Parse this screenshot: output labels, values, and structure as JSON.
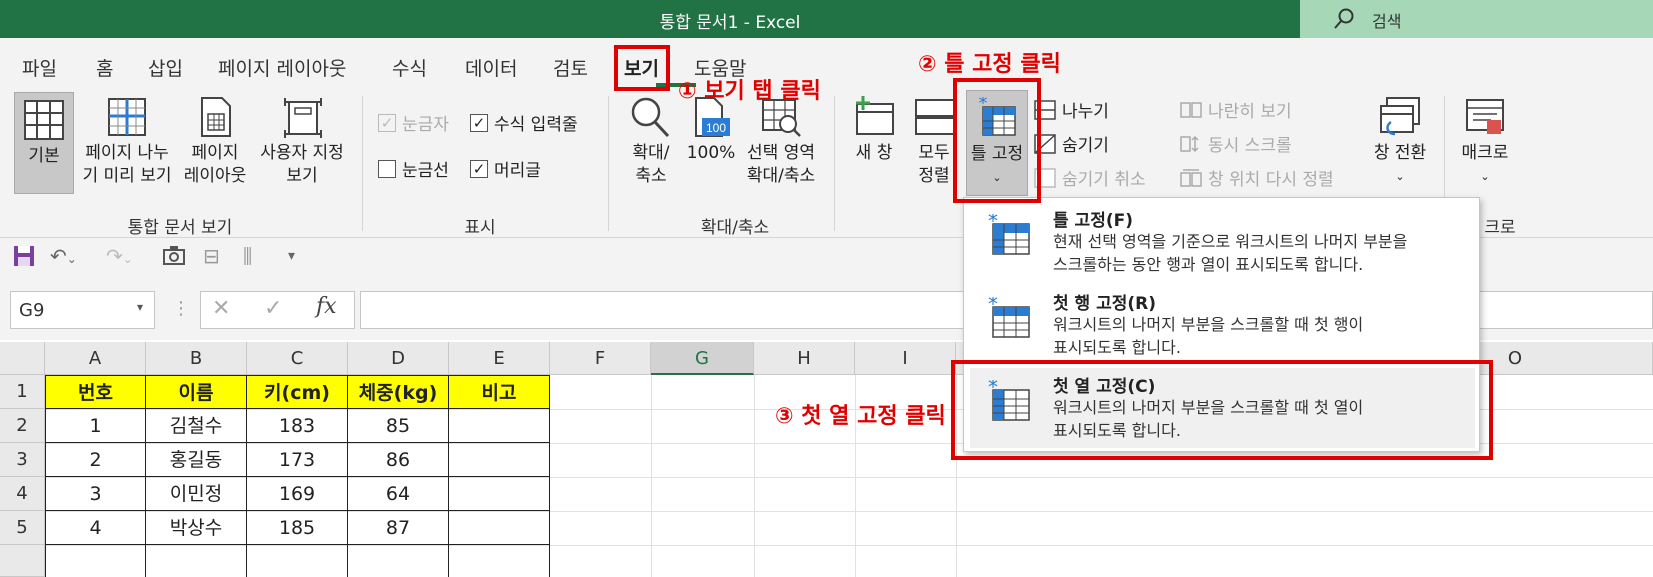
{
  "window": {
    "title": "통합 문서1  -  Excel",
    "search_label": "검색"
  },
  "tabs": [
    "파일",
    "홈",
    "삽입",
    "페이지 레이아웃",
    "수식",
    "데이터",
    "검토",
    "보기",
    "도움말"
  ],
  "ribbon": {
    "workbook_views": {
      "label": "통합 문서 보기",
      "normal": "기본",
      "page_break_1": "페이지 나누",
      "page_break_2": "기 미리 보기",
      "page_layout_1": "페이지",
      "page_layout_2": "레이아웃",
      "custom_1": "사용자 지정",
      "custom_2": "보기"
    },
    "show": {
      "label": "표시",
      "ruler": "눈금자",
      "formula_bar": "수식 입력줄",
      "gridlines": "눈금선",
      "headings": "머리글"
    },
    "zoom": {
      "label": "확대/축소",
      "zoom_1": "확대/",
      "zoom_2": "축소",
      "hundred": "100%",
      "sel_1": "선택 영역",
      "sel_2": "확대/축소"
    },
    "window": {
      "new_window": "새 창",
      "arrange_1": "모두",
      "arrange_2": "정렬",
      "freeze": "틀 고정",
      "split": "나누기",
      "hide": "숨기기",
      "unhide": "숨기기 취소",
      "side_by_side": "나란히 보기",
      "sync_scroll": "동시 스크롤",
      "reset_pos": "창 위치 다시 정렬",
      "switch": "창 전환"
    },
    "macros": {
      "macro": "매크로",
      "label": "크로"
    }
  },
  "formula_bar": {
    "name_box": "G9",
    "fx": "fx",
    "value": ""
  },
  "columns": [
    "A",
    "B",
    "C",
    "D",
    "E",
    "F",
    "G",
    "H",
    "I",
    "O"
  ],
  "rows": [
    "1",
    "2",
    "3",
    "4",
    "5"
  ],
  "table": {
    "headers": [
      "번호",
      "이름",
      "키(cm)",
      "체중(kg)",
      "비고"
    ],
    "rows": [
      [
        "1",
        "김철수",
        "183",
        "85",
        ""
      ],
      [
        "2",
        "홍길동",
        "173",
        "86",
        ""
      ],
      [
        "3",
        "이민정",
        "169",
        "64",
        ""
      ],
      [
        "4",
        "박상수",
        "185",
        "87",
        ""
      ]
    ]
  },
  "freeze_menu": {
    "items": [
      {
        "title": "틀 고정(F)",
        "desc1": "현재 선택 영역을 기준으로 워크시트의 나머지 부분을",
        "desc2": "스크롤하는 동안 행과 열이 표시되도록 합니다."
      },
      {
        "title": "첫 행 고정(R)",
        "desc1": "워크시트의 나머지 부분을 스크롤할 때 첫 행이",
        "desc2": "표시되도록 합니다."
      },
      {
        "title": "첫 열 고정(C)",
        "desc1": "워크시트의 나머지 부분을 스크롤할 때 첫 열이",
        "desc2": "표시되도록 합니다."
      }
    ]
  },
  "annotations": {
    "step1": "① 보기 탭 클릭",
    "step2": "② 틀 고정 클릭",
    "step3": "③ 첫 열 고정 클릭"
  },
  "colors": {
    "excel_green": "#217346",
    "annotation_red": "#e00000",
    "header_fill": "#ffff00"
  }
}
